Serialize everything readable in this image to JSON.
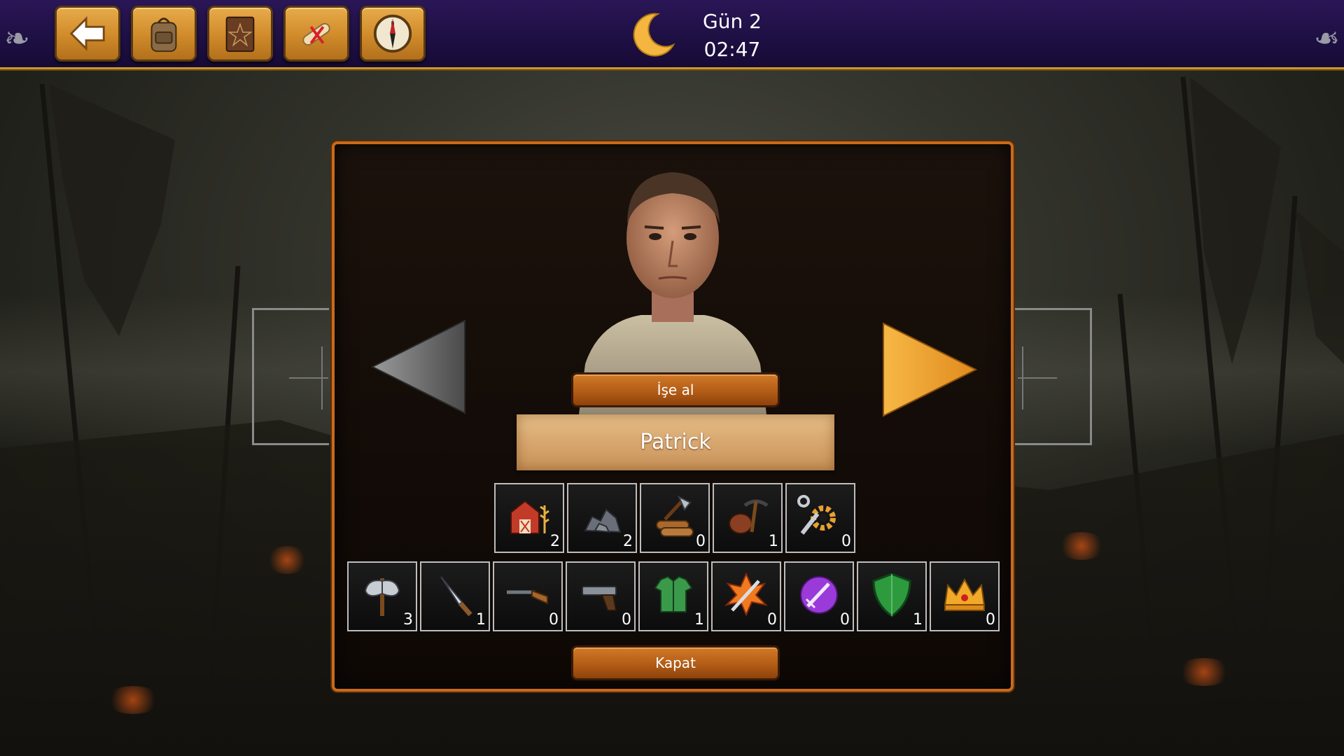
{
  "topbar": {
    "buttons": [
      {
        "name": "back-button",
        "icon": "back-arrow-icon"
      },
      {
        "name": "backpack-button",
        "icon": "backpack-icon"
      },
      {
        "name": "spellbook-button",
        "icon": "spellbook-icon"
      },
      {
        "name": "scroll-button",
        "icon": "scroll-icon"
      },
      {
        "name": "compass-button",
        "icon": "compass-icon"
      }
    ],
    "day_label": "Gün 2",
    "time": "02:47",
    "time_icon": "crescent-moon-icon"
  },
  "dialog": {
    "hire_label": "İşe al",
    "character_name": "Patrick",
    "close_label": "Kapat",
    "prev_arrow": "prev-arrow-disabled",
    "next_arrow": "next-arrow-active",
    "skills": [
      {
        "icon": "farm-icon",
        "count": "2"
      },
      {
        "icon": "stone-ore-icon",
        "count": "2"
      },
      {
        "icon": "woodcutting-icon",
        "count": "0"
      },
      {
        "icon": "mining-icon",
        "count": "1"
      },
      {
        "icon": "crafting-gear-icon",
        "count": "0"
      }
    ],
    "combat": [
      {
        "icon": "battle-axe-icon",
        "count": "3"
      },
      {
        "icon": "knife-icon",
        "count": "1"
      },
      {
        "icon": "rifle-icon",
        "count": "0"
      },
      {
        "icon": "pistol-icon",
        "count": "0"
      },
      {
        "icon": "armor-icon",
        "count": "1"
      },
      {
        "icon": "fire-sword-icon",
        "count": "0"
      },
      {
        "icon": "magic-sword-icon",
        "count": "0"
      },
      {
        "icon": "shield-icon",
        "count": "1"
      },
      {
        "icon": "crown-icon",
        "count": "0"
      }
    ]
  },
  "colors": {
    "topbar": "#1d0f42",
    "accent_gold": "#c9962e",
    "panel_border": "#c76b1c",
    "button_orange": "#b35c16",
    "next_arrow": "#f2a531"
  }
}
